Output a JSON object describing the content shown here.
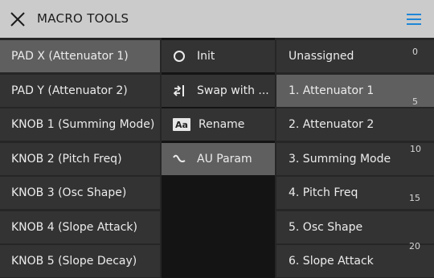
{
  "header": {
    "title": "MACRO TOOLS",
    "close_icon": "close-icon",
    "menu_icon": "hamburger-menu-icon",
    "menu_color": "#1f86d6"
  },
  "targets": [
    {
      "label": "PAD X (Attenuator 1)",
      "selected": true
    },
    {
      "label": "PAD Y (Attenuator 2)",
      "selected": false
    },
    {
      "label": "KNOB 1 (Summing Mode)",
      "selected": false
    },
    {
      "label": "KNOB 2 (Pitch Freq)",
      "selected": false
    },
    {
      "label": "KNOB 3 (Osc Shape)",
      "selected": false
    },
    {
      "label": "KNOB 4 (Slope Attack)",
      "selected": false
    },
    {
      "label": "KNOB 5 (Slope Decay)",
      "selected": false
    }
  ],
  "actions": [
    {
      "label": "Init",
      "icon": "circle-icon",
      "selected": false
    },
    {
      "label": "Swap with ...",
      "icon": "swap-arrows-icon",
      "selected": false
    },
    {
      "label": "Rename",
      "icon": "rename-aa-icon",
      "icon_text": "Aa",
      "selected": false
    },
    {
      "label": "AU Param",
      "icon": "wave-icon",
      "selected": true
    }
  ],
  "parameters": [
    {
      "label": "Unassigned",
      "selected": false
    },
    {
      "label": "1. Attenuator 1",
      "selected": true
    },
    {
      "label": "2. Attenuator 2",
      "selected": false
    },
    {
      "label": "3. Summing Mode",
      "selected": false
    },
    {
      "label": "4. Pitch Freq",
      "selected": false
    },
    {
      "label": "5. Osc Shape",
      "selected": false
    },
    {
      "label": "6. Slope Attack",
      "selected": false
    }
  ],
  "scale": [
    "0",
    "5",
    "10",
    "15",
    "20"
  ]
}
